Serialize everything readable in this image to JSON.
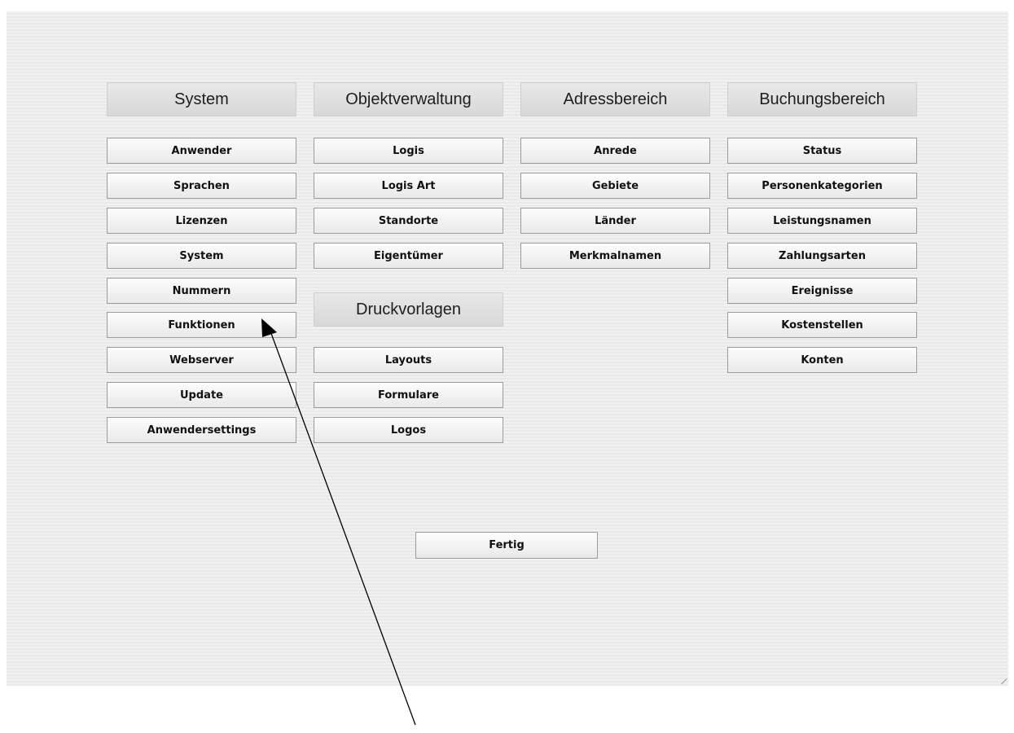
{
  "columns": [
    {
      "header": "System",
      "buttons": [
        "Anwender",
        "Sprachen",
        "Lizenzen",
        "System",
        "Nummern",
        "Funktionen",
        "Webserver",
        "Update",
        "Anwendersettings"
      ]
    },
    {
      "header": "Objektverwaltung",
      "buttons": [
        "Logis",
        "Logis Art",
        "Standorte",
        "Eigentümer"
      ]
    },
    {
      "header": "Adressbereich",
      "buttons": [
        "Anrede",
        "Gebiete",
        "Länder",
        "Merkmalnamen"
      ]
    },
    {
      "header": "Buchungsbereich",
      "buttons": [
        "Status",
        "Personenkategorien",
        "Leistungsnamen",
        "Zahlungsarten",
        "Ereignisse",
        "Kostenstellen",
        "Konten"
      ]
    }
  ],
  "druckvorlagen": {
    "header": "Druckvorlagen",
    "buttons": [
      "Layouts",
      "Formulare",
      "Logos"
    ]
  },
  "done_button": "Fertig",
  "annotation": {
    "type": "arrow",
    "points_to": "Funktionen",
    "color": "#000000"
  }
}
